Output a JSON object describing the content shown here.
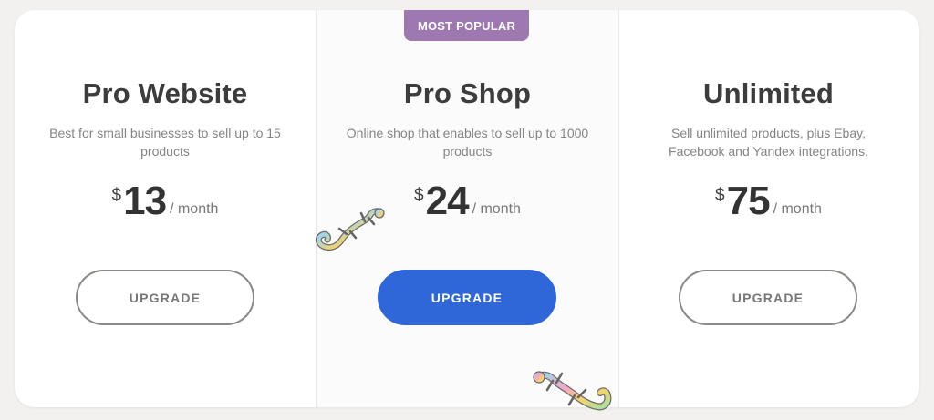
{
  "badge": {
    "label": "MOST POPULAR",
    "color": "#9e78b1"
  },
  "plans": [
    {
      "name": "Pro Website",
      "description": "Best for small businesses to sell up to 15 products",
      "currency": "$",
      "amount": "13",
      "period": "/ month",
      "button_label": "UPGRADE",
      "button_style": "outline"
    },
    {
      "name": "Pro Shop",
      "description": "Online shop that enables to sell up to 1000 products",
      "currency": "$",
      "amount": "24",
      "period": "/ month",
      "button_label": "UPGRADE",
      "button_style": "primary"
    },
    {
      "name": "Unlimited",
      "description": "Sell unlimited products, plus Ebay, Facebook and Yandex integrations.",
      "currency": "$",
      "amount": "75",
      "period": "/ month",
      "button_label": "UPGRADE",
      "button_style": "outline"
    }
  ],
  "colors": {
    "primary_button": "#2f66d8",
    "outline_border": "#8a8985",
    "heading": "#3c3c3c"
  },
  "decorations": [
    "gecko-icon",
    "gecko-icon"
  ]
}
